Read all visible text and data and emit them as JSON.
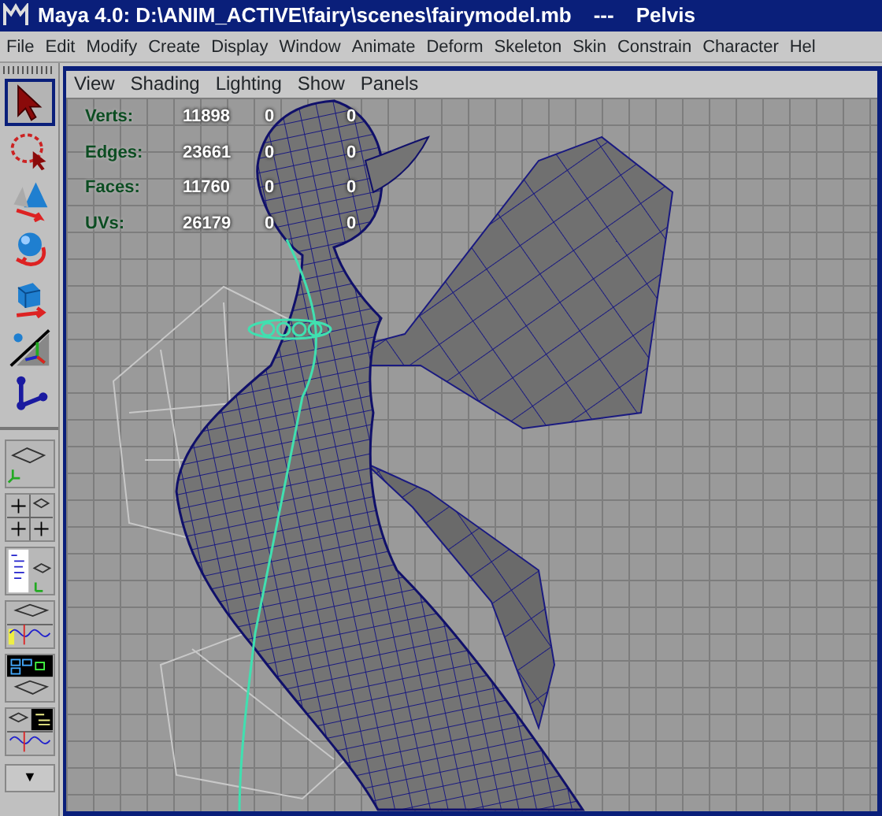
{
  "window": {
    "title": "Maya 4.0: D:\\ANIM_ACTIVE\\fairy\\scenes\\fairymodel.mb",
    "separator": "---",
    "object": "Pelvis"
  },
  "menu": [
    "File",
    "Edit",
    "Modify",
    "Create",
    "Display",
    "Window",
    "Animate",
    "Deform",
    "Skeleton",
    "Skin",
    "Constrain",
    "Character",
    "Hel"
  ],
  "panel_menu": [
    "View",
    "Shading",
    "Lighting",
    "Show",
    "Panels"
  ],
  "tools": [
    {
      "kind": "select",
      "selected": true
    },
    {
      "kind": "lasso",
      "selected": false
    },
    {
      "kind": "move",
      "selected": false
    },
    {
      "kind": "rotate",
      "selected": false
    },
    {
      "kind": "scale",
      "selected": false
    },
    {
      "kind": "manipulator",
      "selected": false
    },
    {
      "kind": "joint",
      "selected": false
    }
  ],
  "layouts": [
    {
      "kind": "single"
    },
    {
      "kind": "quad"
    },
    {
      "kind": "outliner"
    },
    {
      "kind": "graph"
    },
    {
      "kind": "hypergraph"
    },
    {
      "kind": "combo"
    }
  ],
  "layout_more": "▼",
  "hud": [
    {
      "label": "Verts:",
      "values": [
        "11898",
        "0",
        "0"
      ]
    },
    {
      "label": "Edges:",
      "values": [
        "23661",
        "0",
        "0"
      ]
    },
    {
      "label": "Faces:",
      "values": [
        "11760",
        "0",
        "0"
      ]
    },
    {
      "label": "UVs:",
      "values": [
        "26179",
        "0",
        "0"
      ]
    }
  ]
}
